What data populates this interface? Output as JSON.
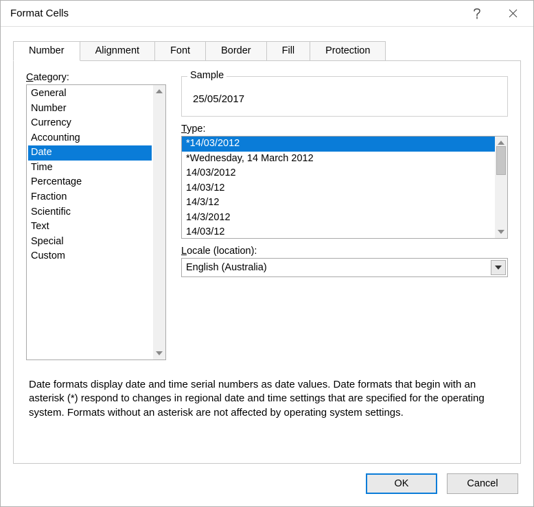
{
  "window": {
    "title": "Format Cells"
  },
  "tabs": [
    "Number",
    "Alignment",
    "Font",
    "Border",
    "Fill",
    "Protection"
  ],
  "activeTab": "Number",
  "labels": {
    "category": "ategory:",
    "categoryPrefix": "C",
    "type": "ype:",
    "typePrefix": "T",
    "locale": "ocale (location):",
    "localePrefix": "L",
    "sample": "Sample"
  },
  "categories": [
    "General",
    "Number",
    "Currency",
    "Accounting",
    "Date",
    "Time",
    "Percentage",
    "Fraction",
    "Scientific",
    "Text",
    "Special",
    "Custom"
  ],
  "selectedCategory": "Date",
  "sampleValue": "25/05/2017",
  "types": [
    "*14/03/2012",
    "*Wednesday, 14 March 2012",
    "14/03/2012",
    "14/03/12",
    "14/3/12",
    "14/3/2012",
    "14/03/12"
  ],
  "selectedType": "*14/03/2012",
  "locale": "English (Australia)",
  "description": "Date formats display date and time serial numbers as date values.  Date formats that begin with an asterisk (*) respond to changes in regional date and time settings that are specified for the operating system. Formats without an asterisk are not affected by operating system settings.",
  "buttons": {
    "ok": "OK",
    "cancel": "Cancel"
  }
}
